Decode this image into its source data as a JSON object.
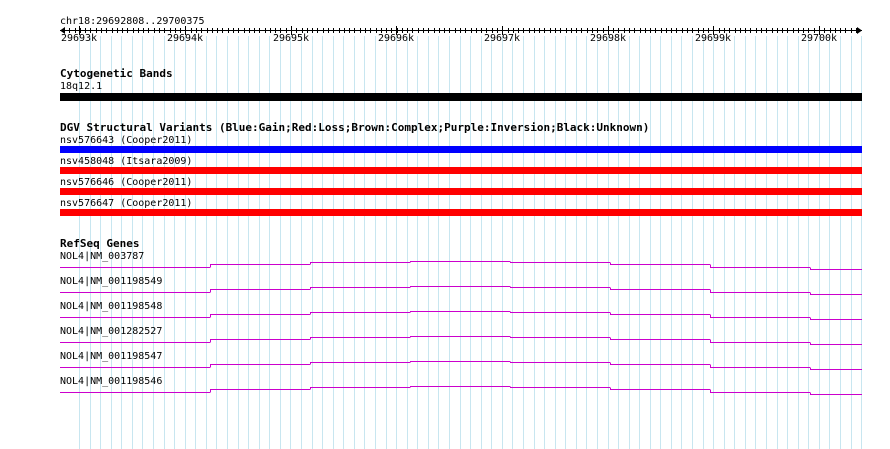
{
  "ruler": {
    "locus": "chr18:29692808..29700375",
    "ticks": [
      "29693k",
      "29694k",
      "29695k",
      "29696k",
      "29697k",
      "29698k",
      "29699k",
      "29700k"
    ]
  },
  "tracks": {
    "cytoband": {
      "title": "Cytogenetic Bands",
      "feature_label": "18q12.1",
      "color": "#000000"
    },
    "dgv": {
      "title": "DGV Structural Variants (Blue:Gain;Red:Loss;Brown:Complex;Purple:Inversion;Black:Unknown)",
      "features": [
        {
          "label": "nsv576643 (Cooper2011)",
          "color": "#0000ff"
        },
        {
          "label": "nsv458048 (Itsara2009)",
          "color": "#ff0000"
        },
        {
          "label": "nsv576646 (Cooper2011)",
          "color": "#ff0000"
        },
        {
          "label": "nsv576647 (Cooper2011)",
          "color": "#ff0000"
        }
      ]
    },
    "refseq": {
      "title": "RefSeq Genes",
      "color": "#cc00cc",
      "genes": [
        {
          "label": "NOL4|NM_003787"
        },
        {
          "label": "NOL4|NM_001198549"
        },
        {
          "label": "NOL4|NM_001198548"
        },
        {
          "label": "NOL4|NM_001282527"
        },
        {
          "label": "NOL4|NM_001198547"
        },
        {
          "label": "NOL4|NM_001198546"
        }
      ]
    }
  },
  "colors": {
    "grid_line": "#c8e6f0",
    "ruler": "#000000"
  }
}
